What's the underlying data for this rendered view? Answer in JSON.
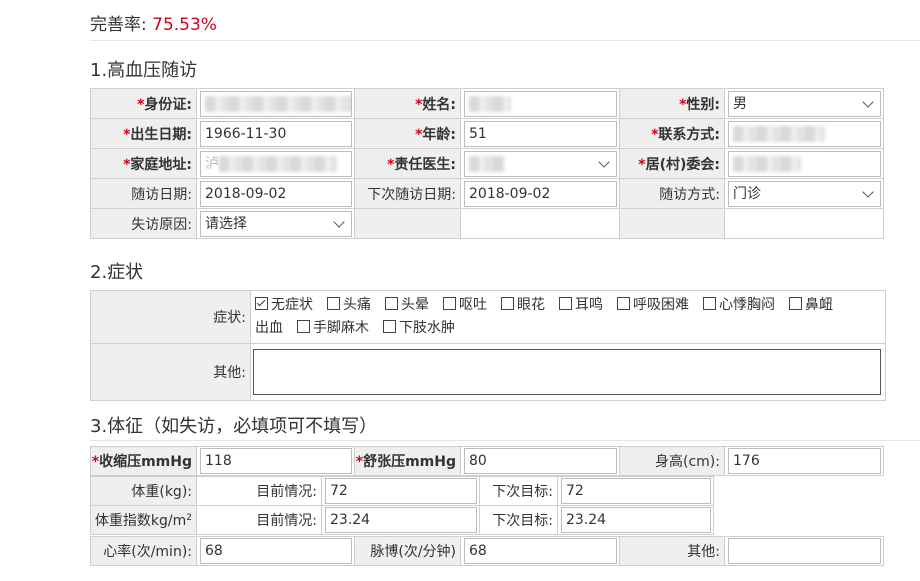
{
  "completion": {
    "label": "完善率:",
    "value": "75.53%"
  },
  "sections": {
    "s1": "1.高血压随访",
    "s2": "2.症状",
    "s3": "3.体征（如失访，必填项可不填写）"
  },
  "basic": {
    "id_label": "身份证:",
    "name_label": "姓名:",
    "gender_label": "性别:",
    "gender_value": "男",
    "dob_label": "出生日期:",
    "dob_value": "1966-11-30",
    "age_label": "年龄:",
    "age_value": "51",
    "contact_label": "联系方式:",
    "address_label": "家庭地址:",
    "address_prefix": "泸",
    "doctor_label": "责任医生:",
    "committee_label": "居(村)委会:",
    "visit_date_label": "随访日期:",
    "visit_date_value": "2018-09-02",
    "next_visit_label": "下次随访日期:",
    "next_visit_value": "2018-09-02",
    "visit_method_label": "随访方式:",
    "visit_method_value": "门诊",
    "lost_reason_label": "失访原因:",
    "lost_reason_value": "请选择",
    "required_mark": "*"
  },
  "symptoms": {
    "label": "症状:",
    "items": [
      {
        "text": "无症状",
        "checked": true
      },
      {
        "text": "头痛",
        "checked": false
      },
      {
        "text": "头晕",
        "checked": false
      },
      {
        "text": "呕吐",
        "checked": false
      },
      {
        "text": "眼花",
        "checked": false
      },
      {
        "text": "耳鸣",
        "checked": false
      },
      {
        "text": "呼吸困难",
        "checked": false
      },
      {
        "text": "心悸胸闷",
        "checked": false
      },
      {
        "text": "鼻衄",
        "checked": false
      },
      {
        "text": "出血",
        "checked": false
      },
      {
        "text": "手脚麻木",
        "checked": false
      },
      {
        "text": "下肢水肿",
        "checked": false
      }
    ],
    "other_label": "其他:"
  },
  "vitals": {
    "systolic_label": "收缩压mmHg",
    "systolic_value": "118",
    "diastolic_label": "舒张压mmHg",
    "diastolic_value": "80",
    "height_label": "身高(cm):",
    "height_value": "176",
    "weight_label": "体重(kg):",
    "current_label": "目前情况:",
    "next_target_label": "下次目标:",
    "weight_current": "72",
    "weight_target": "72",
    "bmi_label": "体重指数kg/m",
    "bmi_sup": "2",
    "bmi_current": "23.24",
    "bmi_target": "23.24",
    "heart_rate_label": "心率(次/min):",
    "heart_rate_value": "68",
    "pulse_label": "脉博(次/分钟)",
    "pulse_value": "68",
    "other_label": "其他:",
    "other_value": ""
  }
}
